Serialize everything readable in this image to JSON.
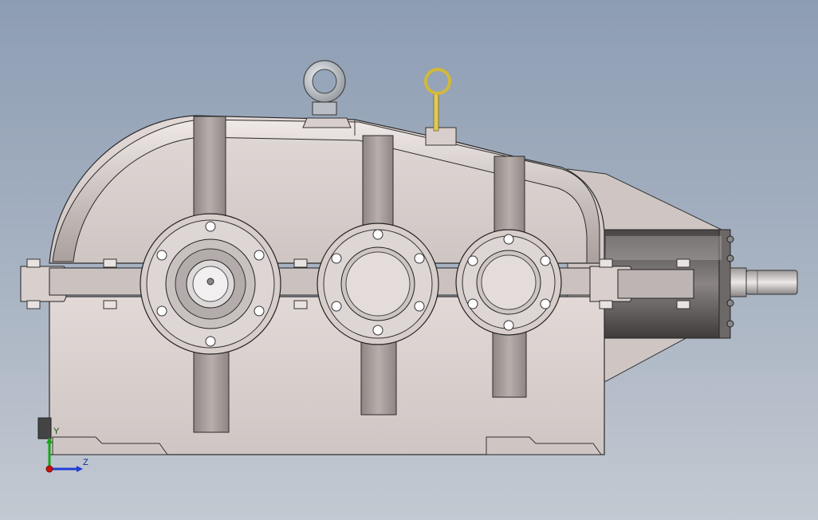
{
  "viewport": {
    "background_top": "#8d9db3",
    "background_bottom": "#c3c9d1"
  },
  "model": {
    "housing_color": "#d8cfcd",
    "rib_color": "#a79e9b",
    "dark_metal": "#5b5656",
    "eyebolt_color": "#c9ced4",
    "dipstick_color": "#d3b93a"
  },
  "triad": {
    "y_label": "Y",
    "z_label": "Z",
    "y_color": "#1aa31a",
    "z_color": "#1f3fd6",
    "x_color": "#d01010"
  }
}
